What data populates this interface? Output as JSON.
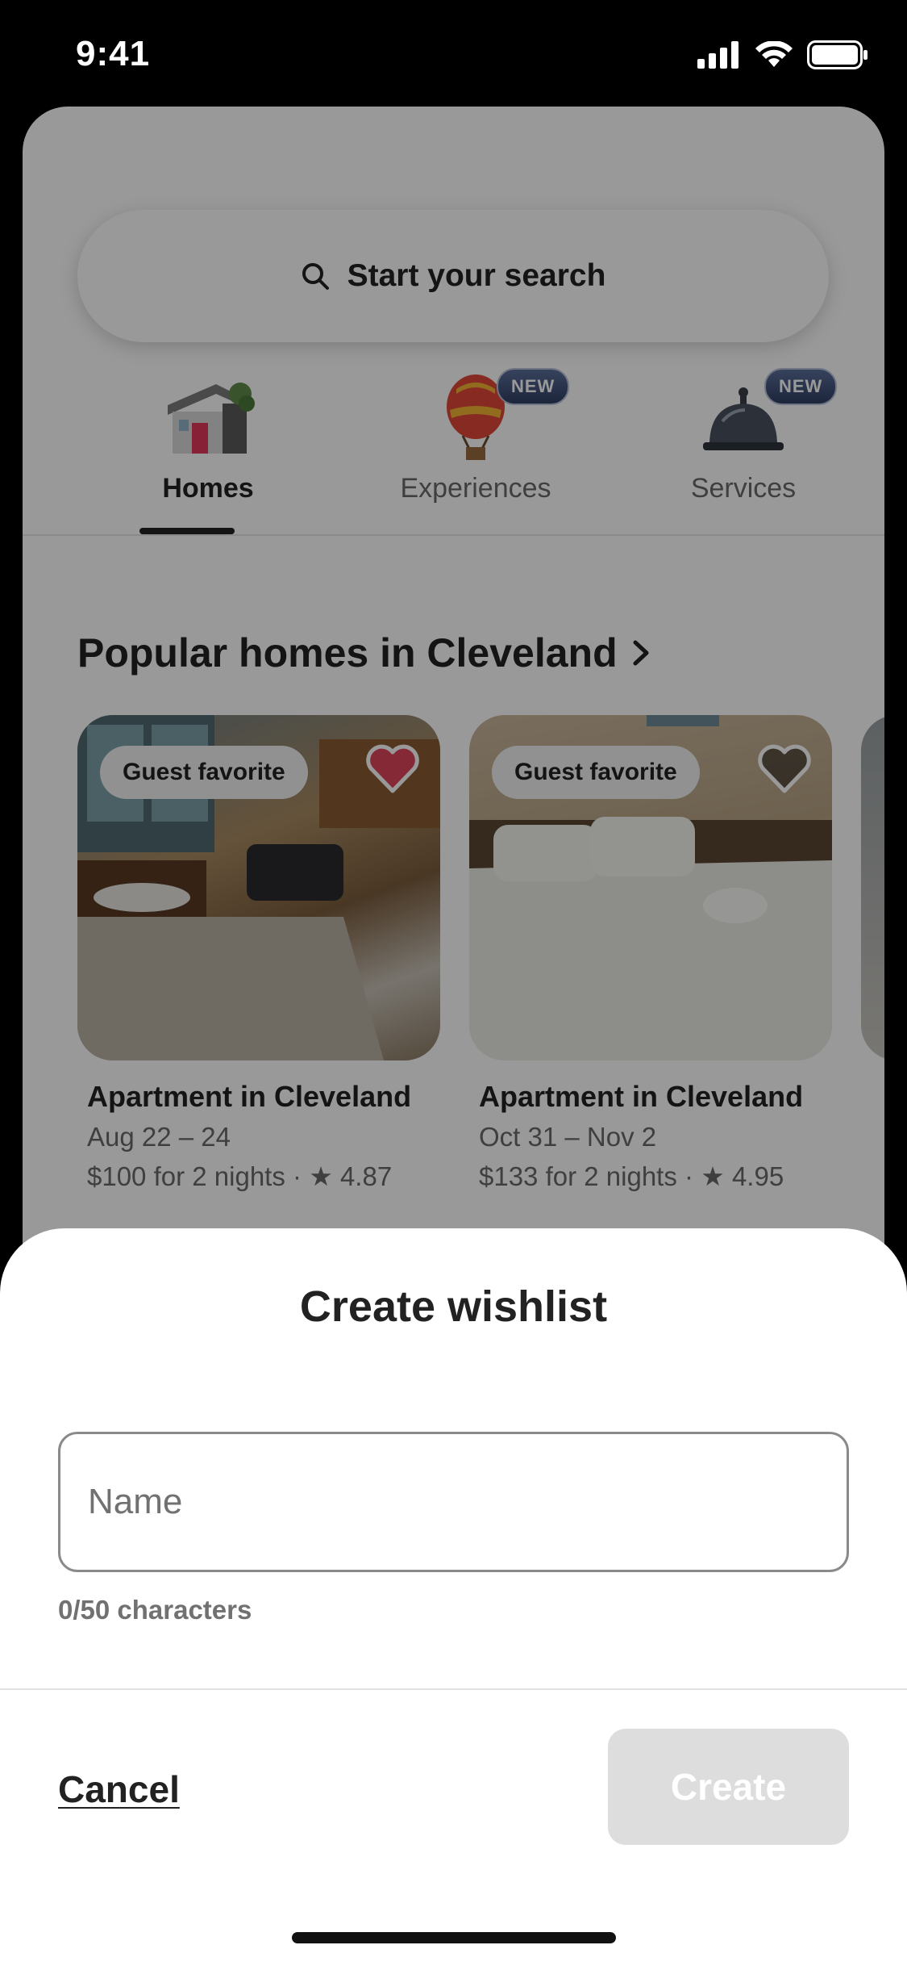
{
  "status_bar": {
    "time": "9:41"
  },
  "search": {
    "placeholder": "Start your search"
  },
  "categories": [
    {
      "label": "Homes",
      "icon": "house-icon",
      "active": true
    },
    {
      "label": "Experiences",
      "icon": "hot-air-balloon-icon",
      "badge": "NEW"
    },
    {
      "label": "Services",
      "icon": "service-bell-icon",
      "badge": "NEW"
    }
  ],
  "section": {
    "title": "Popular homes in Cleveland"
  },
  "listings": [
    {
      "badge": "Guest favorite",
      "favorited": true,
      "title": "Apartment in Cleveland",
      "dates": "Aug 22 – 24",
      "price": "$100 for 2 nights",
      "rating": "4.87"
    },
    {
      "badge": "Guest favorite",
      "favorited": false,
      "title": "Apartment in Cleveland",
      "dates": "Oct 31 – Nov 2",
      "price": "$133 for 2 nights",
      "rating": "4.95"
    }
  ],
  "sheet": {
    "title": "Create wishlist",
    "name_placeholder": "Name",
    "char_count": "0/50 characters",
    "cancel_label": "Cancel",
    "create_label": "Create"
  },
  "colors": {
    "heart_active": "#e0455d",
    "create_disabled": "#dddddd"
  }
}
